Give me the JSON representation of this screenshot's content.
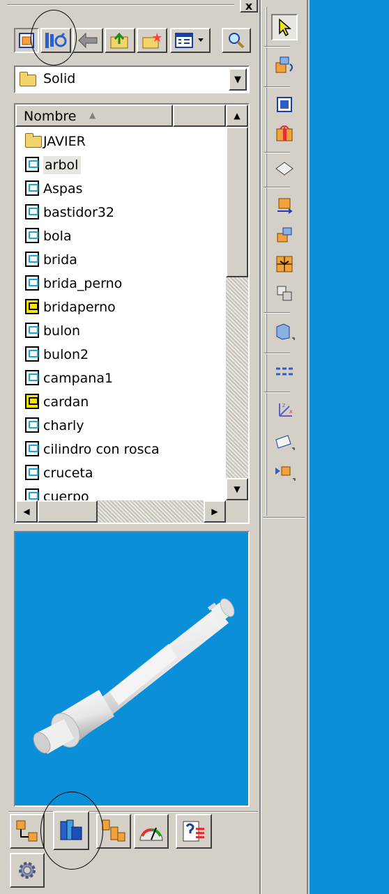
{
  "folder_select": {
    "value": "Solid",
    "arrow": "▼"
  },
  "list": {
    "header": {
      "column1": "Nombre",
      "sort_arrow": "▲"
    },
    "items": [
      {
        "label": "JAVIER",
        "icon": "folder-icon"
      },
      {
        "label": "arbol",
        "icon": "part-file-icon"
      },
      {
        "label": "Aspas",
        "icon": "part-file-icon"
      },
      {
        "label": "bastidor32",
        "icon": "part-file-icon"
      },
      {
        "label": "bola",
        "icon": "part-file-icon"
      },
      {
        "label": "brida",
        "icon": "part-file-icon"
      },
      {
        "label": "brida_perno",
        "icon": "part-file-icon"
      },
      {
        "label": "bridaperno",
        "icon": "assembly-file-icon"
      },
      {
        "label": "bulon",
        "icon": "part-file-icon"
      },
      {
        "label": "bulon2",
        "icon": "part-file-icon"
      },
      {
        "label": "campana1",
        "icon": "part-file-icon"
      },
      {
        "label": "cardan",
        "icon": "assembly-file-icon"
      },
      {
        "label": "charly",
        "icon": "part-file-icon"
      },
      {
        "label": "cilindro con rosca",
        "icon": "part-file-icon"
      },
      {
        "label": "cruceta",
        "icon": "part-file-icon"
      },
      {
        "label": "cuerpo",
        "icon": "part-file-icon"
      }
    ],
    "scroll_up": "▲",
    "scroll_down": "▼",
    "scroll_left": "◀",
    "scroll_right": "▶"
  },
  "close_glyph": "x",
  "colors": {
    "panel": "#d4d0c8",
    "preview_bg": "#0b8fd8",
    "accent_blue": "#0b8fd8"
  }
}
